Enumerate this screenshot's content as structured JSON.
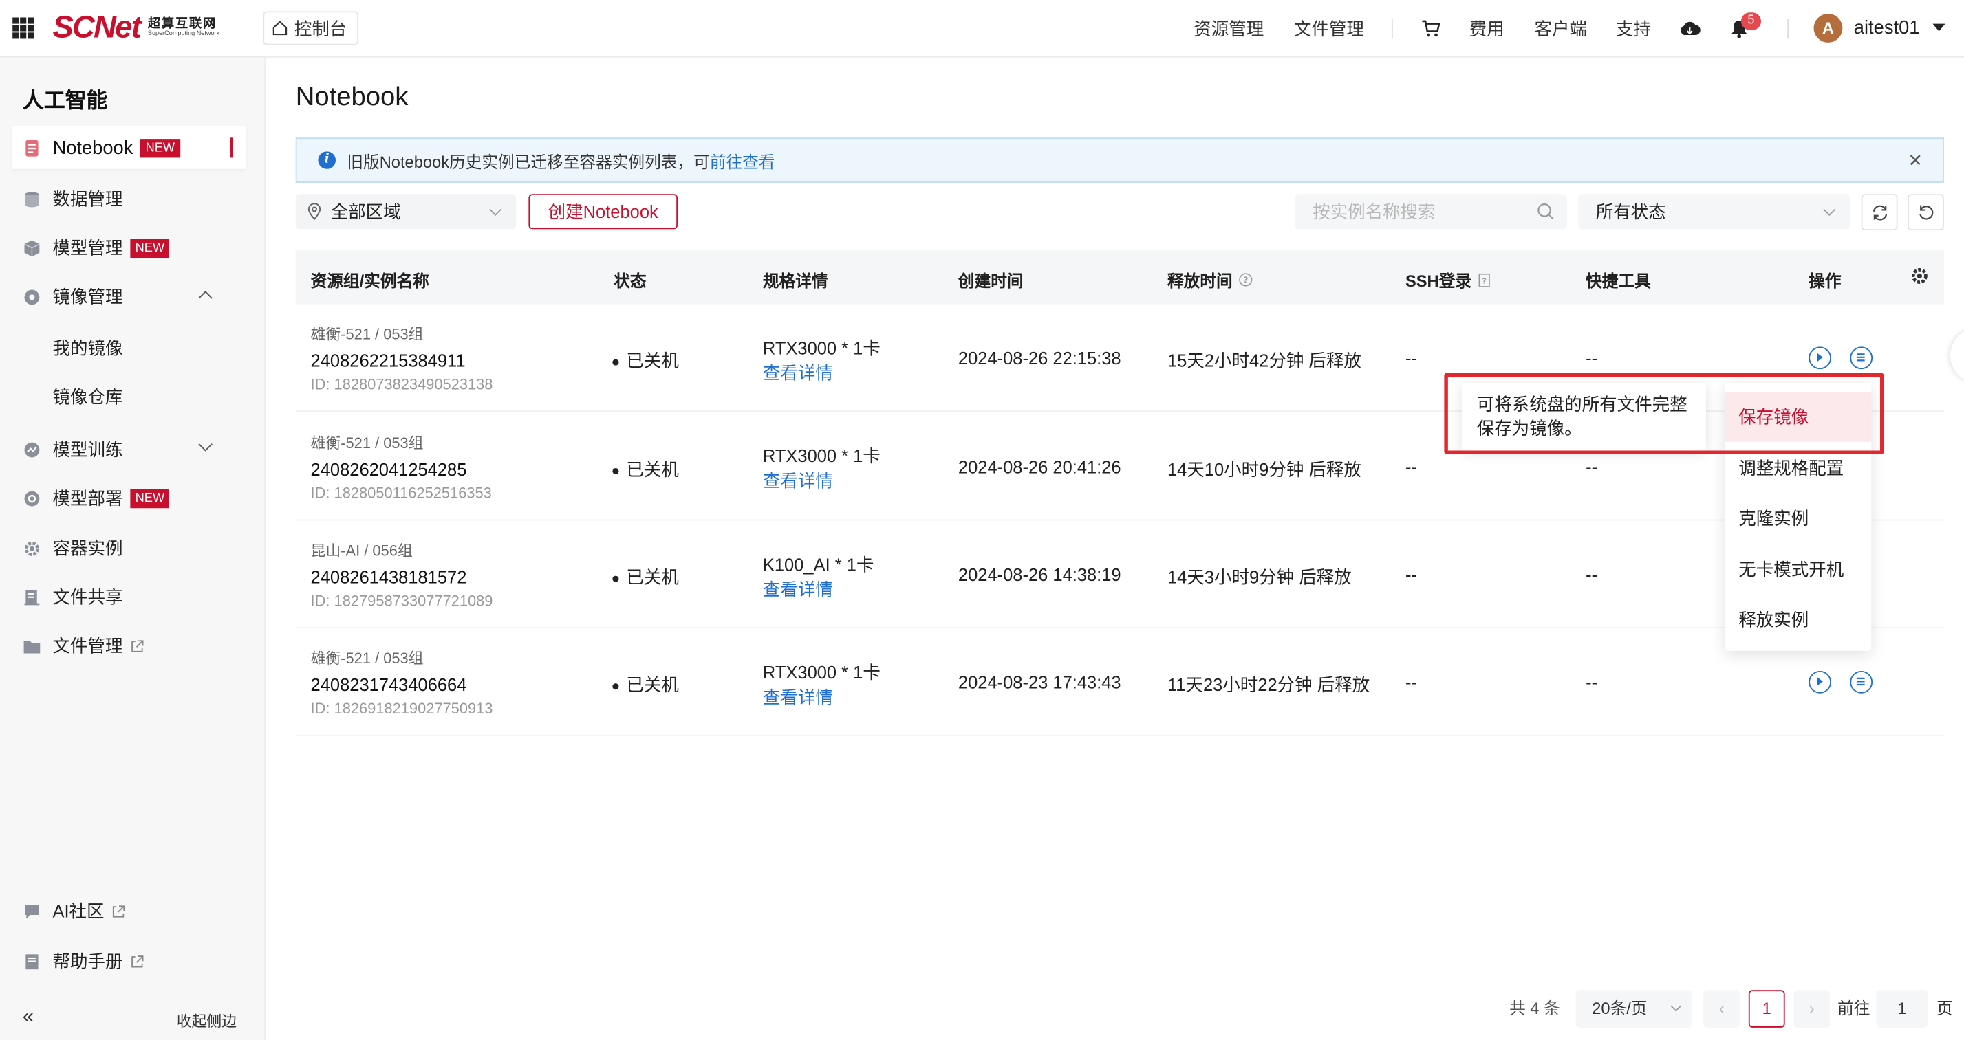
{
  "brand": {
    "logo_text": "SCNet",
    "logo_cn": "超算互联网",
    "logo_en": "SuperComputing Network"
  },
  "header": {
    "console_label": "控制台",
    "nav": [
      "资源管理",
      "文件管理"
    ],
    "right_nav": [
      "费用",
      "客户端",
      "支持"
    ],
    "notification_count": "5",
    "avatar_letter": "A",
    "username": "aitest01"
  },
  "sidebar": {
    "section_title": "人工智能",
    "items": [
      {
        "label": "Notebook",
        "badge": "NEW"
      },
      {
        "label": "数据管理"
      },
      {
        "label": "模型管理",
        "badge": "NEW"
      },
      {
        "label": "镜像管理"
      },
      {
        "label": "我的镜像"
      },
      {
        "label": "镜像仓库"
      },
      {
        "label": "模型训练"
      },
      {
        "label": "模型部署",
        "badge": "NEW"
      },
      {
        "label": "容器实例"
      },
      {
        "label": "文件共享"
      },
      {
        "label": "文件管理"
      }
    ],
    "footer_items": [
      {
        "label": "AI社区"
      },
      {
        "label": "帮助手册"
      }
    ],
    "collapse_label": "收起侧边"
  },
  "page": {
    "title": "Notebook",
    "notice_text": "旧版Notebook历史实例已迁移至容器实例列表，可",
    "notice_link": "前往查看",
    "region_label": "全部区域",
    "create_label": "创建Notebook",
    "search_placeholder": "按实例名称搜索",
    "status_filter": "所有状态"
  },
  "table": {
    "columns": [
      "资源组/实例名称",
      "状态",
      "规格详情",
      "创建时间",
      "释放时间",
      "SSH登录",
      "快捷工具",
      "操作"
    ],
    "detail_link": "查看详情",
    "rows": [
      {
        "group": "雄衡-521 / 053组",
        "name": "2408262215384911",
        "id": "ID: 1828073823490523138",
        "status": "已关机",
        "spec": "RTX3000 * 1卡",
        "created": "2024-08-26 22:15:38",
        "release": "15天2小时42分钟 后释放",
        "ssh": "--",
        "tools": "--"
      },
      {
        "group": "雄衡-521 / 053组",
        "name": "2408262041254285",
        "id": "ID: 1828050116252516353",
        "status": "已关机",
        "spec": "RTX3000 * 1卡",
        "created": "2024-08-26 20:41:26",
        "release": "14天10小时9分钟 后释放",
        "ssh": "--",
        "tools": "--"
      },
      {
        "group": "昆山-AI / 056组",
        "name": "2408261438181572",
        "id": "ID: 1827958733077721089",
        "status": "已关机",
        "spec": "K100_AI * 1卡",
        "created": "2024-08-26 14:38:19",
        "release": "14天3小时9分钟 后释放",
        "ssh": "--",
        "tools": "--"
      },
      {
        "group": "雄衡-521 / 053组",
        "name": "2408231743406664",
        "id": "ID: 1826918219027750913",
        "status": "已关机",
        "spec": "RTX3000 * 1卡",
        "created": "2024-08-23 17:43:43",
        "release": "11天23小时22分钟 后释放",
        "ssh": "--",
        "tools": "--"
      }
    ]
  },
  "dropdown": {
    "items": [
      "保存镜像",
      "调整规格配置",
      "克隆实例",
      "无卡模式开机",
      "释放实例"
    ],
    "tooltip": "可将系统盘的所有文件完整保存为镜像。"
  },
  "pagination": {
    "total": "共 4 条",
    "page_size": "20条/页",
    "current_page": "1",
    "goto_label": "前往",
    "goto_value": "1",
    "page_suffix": "页"
  },
  "colors": {
    "brand_red": "#c8102e",
    "link_blue": "#1f6fd0",
    "highlight_outline": "#e0282e"
  }
}
